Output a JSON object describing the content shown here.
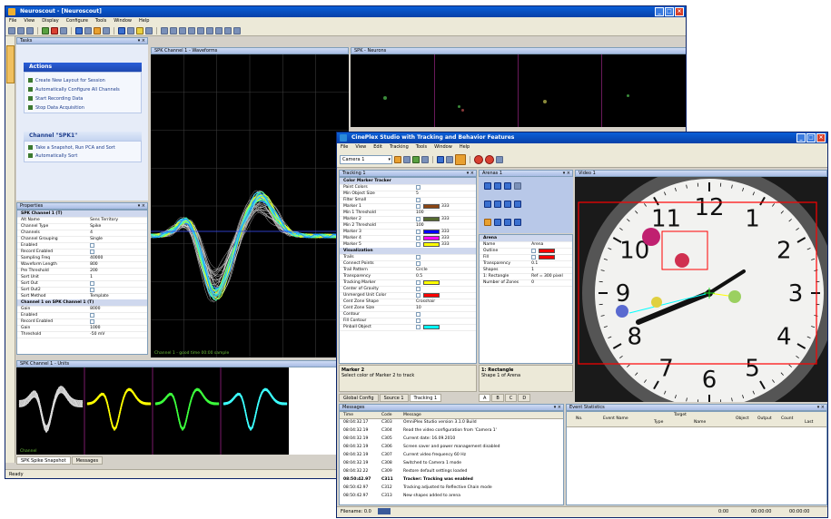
{
  "back_window": {
    "title": "Neuroscout - [Neuroscout]",
    "menu": [
      "File",
      "View",
      "Display",
      "Configure",
      "Tools",
      "Window",
      "Help"
    ],
    "status": "Ready",
    "dock_title": "Tasks",
    "tasks_panel": {
      "header": "Actions",
      "items": [
        "Create New Layout for Session",
        "Automatically Configure All Channels",
        "Start Recording Data",
        "Stop Data Acquisition"
      ],
      "selected_header": "Channel \"SPK1\"",
      "selected_items": [
        "Take a Snapshot, Run PCA and Sort",
        "Automatically Sort"
      ]
    },
    "properties": {
      "title": "Properties",
      "category1": "SPK Channel 1 (T)",
      "rows": [
        {
          "name": "Alt Name",
          "value": "Sens Territory"
        },
        {
          "name": "Channel Type",
          "value": "Spike"
        },
        {
          "name": "Channels",
          "value": "4"
        },
        {
          "name": "Channel Grouping",
          "value": "Single"
        },
        {
          "name": "Enabled",
          "value": ""
        },
        {
          "name": "Record Enabled",
          "value": ""
        },
        {
          "name": "Sampling Freq",
          "value": "40000"
        },
        {
          "name": "Waveform Length",
          "value": "800"
        },
        {
          "name": "Pre Threshold",
          "value": "200"
        },
        {
          "name": "Sort Unit",
          "value": "1"
        },
        {
          "name": "Sort Out",
          "value": ""
        },
        {
          "name": "Sort Out2",
          "value": ""
        },
        {
          "name": "Sort Method",
          "value": "Template"
        }
      ],
      "category2": "Channel 1 on SPK Channel 1 (T)",
      "rows2": [
        {
          "name": "Gain",
          "value": "8000"
        },
        {
          "name": "Enabled",
          "value": ""
        },
        {
          "name": "Record Enabled",
          "value": ""
        },
        {
          "name": "Gain",
          "value": "1000"
        },
        {
          "name": "Threshold",
          "value": "-50 mV"
        }
      ]
    },
    "spike_panel_title": "SPK Channel 1 - Waveforms",
    "spike_overlay_text": "Channel 1 - good time 00:00 sample",
    "video_panel_title": "SPK - Neurons",
    "units_panel_title": "SPK Channel 1 - Units",
    "units_footer": "Channel",
    "tabs": [
      "SPK Spike Snapshot",
      "Messages"
    ]
  },
  "front_window": {
    "title": "CinePlex Studio with Tracking and Behavior Features",
    "menu": [
      "File",
      "View",
      "Edit",
      "Tracking",
      "Tools",
      "Window",
      "Help"
    ],
    "camera_select": "Camera 1",
    "tracking_panel": {
      "title": "Tracking 1",
      "category": "Color Marker Tracker",
      "rows": [
        {
          "name": "Paint Colors",
          "value": ""
        },
        {
          "name": "Min Object Size",
          "value": "5"
        },
        {
          "name": "Filter Small",
          "value": ""
        },
        {
          "name": "Marker 1",
          "value": "333"
        },
        {
          "name": "Min 1 Threshold",
          "value": "100"
        },
        {
          "name": "Marker 2",
          "value": "333"
        },
        {
          "name": "Min 2 Threshold",
          "value": "100"
        },
        {
          "name": "Marker 3",
          "value": "333"
        },
        {
          "name": "Marker 4",
          "value": "333"
        },
        {
          "name": "Marker 5",
          "value": "333"
        }
      ],
      "category2": "Visualization",
      "rows2": [
        {
          "name": "Trails",
          "value": ""
        },
        {
          "name": "Connect Points",
          "value": ""
        },
        {
          "name": "Trail Pattern",
          "value": "Circle"
        },
        {
          "name": "Transparency",
          "value": "0.5"
        },
        {
          "name": "Tracking Marker",
          "value": ""
        },
        {
          "name": "Center of Gravity",
          "value": ""
        },
        {
          "name": "Unmerged Unit Color",
          "value": ""
        },
        {
          "name": "Cent Zone Shape",
          "value": "Crosshair"
        },
        {
          "name": "Cent Zone Size",
          "value": "10"
        },
        {
          "name": "Contour",
          "value": ""
        },
        {
          "name": "Fill Contour",
          "value": ""
        },
        {
          "name": "Pinball Object",
          "value": ""
        }
      ],
      "footer_title": "Marker 2",
      "footer_desc": "Select color of Marker 2 to track"
    },
    "arena_panel": {
      "title": "Arenas 1",
      "category": "Arena",
      "rows": [
        {
          "name": "Name",
          "value": "Arena"
        },
        {
          "name": "Outline",
          "value": ""
        },
        {
          "name": "Fill",
          "value": ""
        },
        {
          "name": "Transparency",
          "value": "0.1"
        },
        {
          "name": "Shapes",
          "value": "1"
        },
        {
          "name": "1: Rectangle",
          "value": "Ref = 300 pixel"
        },
        {
          "name": "Number of Zones",
          "value": "0"
        }
      ],
      "footer_title": "1: Rectangle",
      "footer_desc": "Shape 1 of Arena"
    },
    "video_panel_title": "Video 1",
    "clock_numbers": [
      "12",
      "1",
      "2",
      "3",
      "4",
      "5",
      "6",
      "7",
      "8",
      "9",
      "10",
      "11"
    ],
    "bottom_tabs": [
      "Global Config",
      "Source 1",
      "Tracking 1"
    ],
    "arena_tabs": [
      "A",
      "B",
      "C",
      "D"
    ],
    "messages": {
      "title": "Messages",
      "headers": [
        "Time",
        "Code",
        "Message"
      ],
      "rows": [
        {
          "time": "08:04:32.17",
          "code": "C303",
          "msg": "OmniPlex Studio version 3.1.0 Build",
          "bold": false
        },
        {
          "time": "08:04:32.19",
          "code": "C304",
          "msg": "Read the video configuration from 'Camera 1'",
          "bold": false
        },
        {
          "time": "08:04:32.19",
          "code": "C305",
          "msg": "Current date: 16.09.2010",
          "bold": false
        },
        {
          "time": "08:04:32.19",
          "code": "C306",
          "msg": "Screen saver and power management disabled",
          "bold": false
        },
        {
          "time": "08:04:32.19",
          "code": "C307",
          "msg": "Current video frequency 60 Hz",
          "bold": false
        },
        {
          "time": "08:04:32.19",
          "code": "C308",
          "msg": "Switched to Camera 1 mode",
          "bold": false
        },
        {
          "time": "08:04:32.22",
          "code": "C309",
          "msg": "Restore default settings loaded",
          "bold": false
        },
        {
          "time": "08:50:42.97",
          "code": "C311",
          "msg": "Tracker: Tracking was enabled",
          "bold": true
        },
        {
          "time": "08:50:42.97",
          "code": "C312",
          "msg": "Tracking adjusted to Reflective Chain mode",
          "bold": false
        },
        {
          "time": "08:50:42.97",
          "code": "C313",
          "msg": "New shapes added to arena",
          "bold": false
        }
      ]
    },
    "event_stats": {
      "title": "Event Statistics",
      "headers": [
        "No.",
        "Event Name",
        "Target",
        "Object",
        "Output",
        "Count",
        "Last"
      ],
      "sub_headers": [
        "Type",
        "Name"
      ]
    },
    "status_left": "Filename: 0.0",
    "status_right": [
      "0:00",
      "00:00:00",
      "00:00:00"
    ]
  },
  "colors": {
    "accent": "#0a5fd8",
    "marker1": "#8b4513",
    "marker2": "#556b2f",
    "marker3": "#0000ff",
    "marker4": "#ff00ff",
    "marker5": "#ffff00",
    "trail": "#00ffff",
    "tracking": "#ffff00",
    "unmerged": "#ff0000",
    "arena_outline": "#ff0000"
  }
}
